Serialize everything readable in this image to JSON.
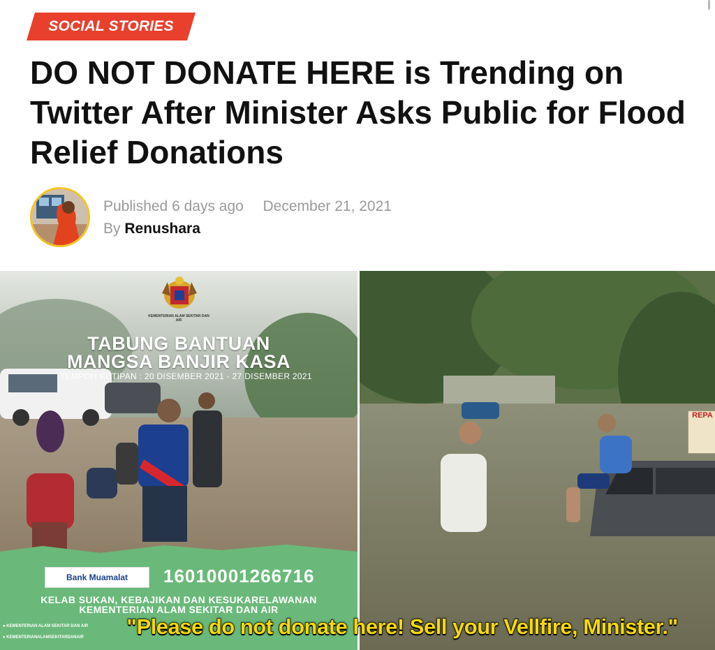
{
  "category": {
    "label": "SOCIAL STORIES",
    "color": "#e8402d"
  },
  "article": {
    "title": "DO NOT DONATE HERE is Trending on Twitter After Minister Asks Public for Flood Relief Donations",
    "published_prefix": "Published",
    "published_relative": "6 days ago",
    "published_date": "December 21, 2021",
    "by_prefix": "By",
    "author": "Renushara"
  },
  "left_image": {
    "ministry_name": "KEMENTERIAN ALAM SEKITAR DAN AIR",
    "title_line1": "TABUNG BANTUAN",
    "title_line2": "MANGSA BANJIR KASA",
    "collection_period": "TEMPOH KUTIPAN : 20 DISEMBER 2021 - 27 DISEMBER 2021",
    "bank_name": "Bank Muamalat",
    "account_number": "16010001266716",
    "club_line1": "KELAB SUKAN, KEBAJIKAN DAN KESUKARELAWANAN",
    "club_line2": "KEMENTERIAN ALAM SEKITAR DAN AIR",
    "social_facebook": "KEMENTERIAN ALAM SEKITAR DAN AIR",
    "social_instagram": "KEMENTERIANALAMSEKITARDANAIR"
  },
  "right_image": {
    "sign_text": "REPA"
  },
  "image_caption": "\"Please do not donate here! Sell your Vellfire, Minister.\""
}
